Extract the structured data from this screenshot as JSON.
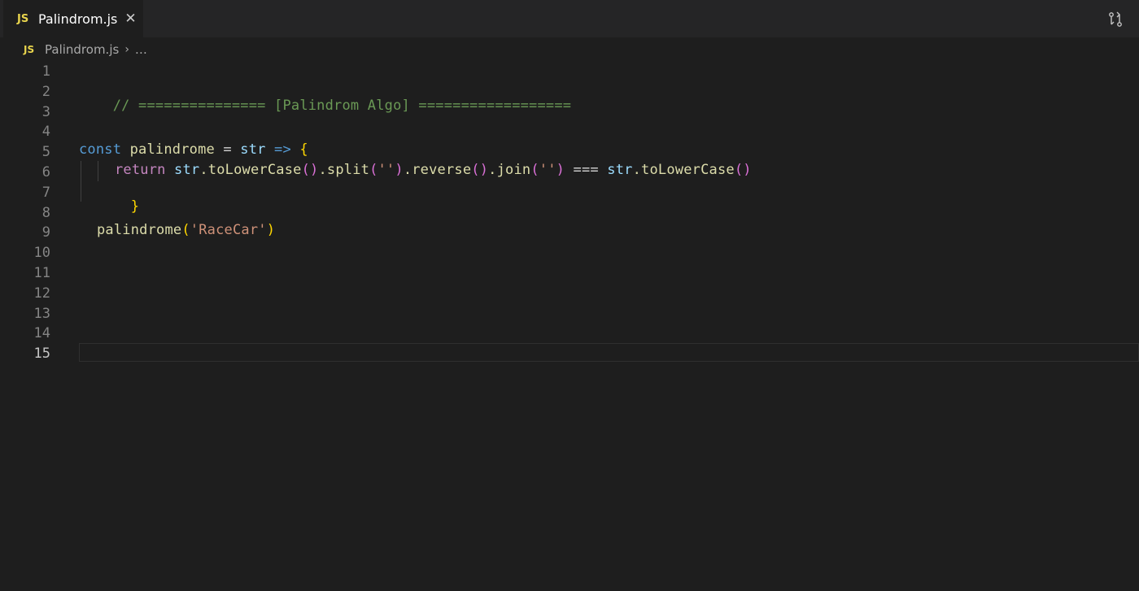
{
  "tab": {
    "icon": "JS",
    "name": "Palindrom.js",
    "close": "✕"
  },
  "breadcrumb": {
    "icon": "JS",
    "file": "Palindrom.js",
    "separator": "›",
    "rest": "…"
  },
  "editor": {
    "line_numbers": [
      "1",
      "2",
      "3",
      "4",
      "5",
      "6",
      "7",
      "8",
      "9",
      "10",
      "11",
      "12",
      "13",
      "14",
      "15"
    ],
    "active_line": "15",
    "line2_comment": "// =============== [Palindrom Algo] ==================",
    "line5": {
      "kw": "const",
      "name": "palindrome",
      "eq": " = ",
      "param": "str",
      "arrow": " => ",
      "brace": "{"
    },
    "line6": {
      "ret": "return",
      "s1": "str",
      "m1": ".toLowerCase",
      "p1": "()",
      "m2": ".split",
      "p2a": "(",
      "q1": "''",
      "p2b": ")",
      "m3": ".reverse",
      "p3": "()",
      "m4": ".join",
      "p4a": "(",
      "q2": "''",
      "p4b": ")",
      "eqeq": " === ",
      "s2": "str",
      "m5": ".toLowerCase",
      "p5": "()"
    },
    "line7": {
      "brace": "}"
    },
    "line9": {
      "fn": "palindrome",
      "p_open": "(",
      "arg": "'RaceCar'",
      "p_close": ")"
    }
  },
  "colors": {
    "background": "#1e1e1e",
    "comment": "#6a9955",
    "keyword": "#569cd6",
    "string": "#ce9178",
    "function": "#dcdcaa"
  }
}
